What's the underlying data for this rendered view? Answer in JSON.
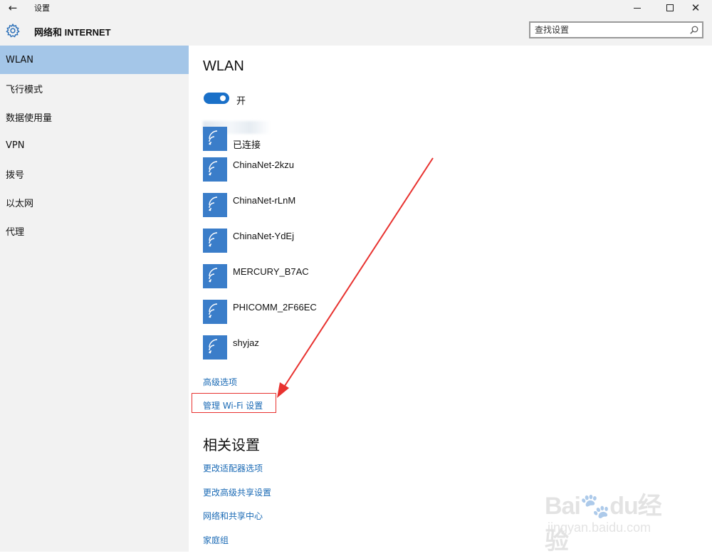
{
  "window": {
    "title": "设置",
    "back_icon": "back-arrow-icon",
    "controls": [
      "minimize-icon",
      "maximize-icon",
      "close-icon"
    ]
  },
  "header": {
    "icon": "gear-icon",
    "title": "网络和 INTERNET",
    "search": {
      "placeholder": "查找设置",
      "icon": "search-icon"
    }
  },
  "sidebar": {
    "items": [
      {
        "label": "WLAN",
        "active": true
      },
      {
        "label": "飞行模式"
      },
      {
        "label": "数据使用量"
      },
      {
        "label": "VPN"
      },
      {
        "label": "拨号"
      },
      {
        "label": "以太网"
      },
      {
        "label": "代理"
      }
    ]
  },
  "main": {
    "title": "WLAN",
    "toggle": {
      "state": "on",
      "label": "开"
    },
    "connected_status": "已连接",
    "networks": [
      {
        "name": "ChinaNet-2kzu"
      },
      {
        "name": "ChinaNet-rLnM"
      },
      {
        "name": "ChinaNet-YdEj"
      },
      {
        "name": "MERCURY_B7AC"
      },
      {
        "name": "PHICOMM_2F66EC"
      },
      {
        "name": "shyjaz"
      }
    ],
    "advanced_link": "高级选项",
    "manage_link": "管理 Wi-Fi 设置",
    "related_title": "相关设置",
    "related_links": [
      "更改适配器选项",
      "更改高级共享设置",
      "网络和共享中心",
      "家庭组"
    ]
  },
  "colors": {
    "accent": "#1a70c8",
    "link": "#1a6ab5",
    "sidebar_active": "#a4c6e8",
    "annotation": "#e8322f",
    "wifi_tile": "#3a7dc9"
  },
  "watermark": {
    "logo": "Baidu经验",
    "url": "jingyan.baidu.com"
  }
}
